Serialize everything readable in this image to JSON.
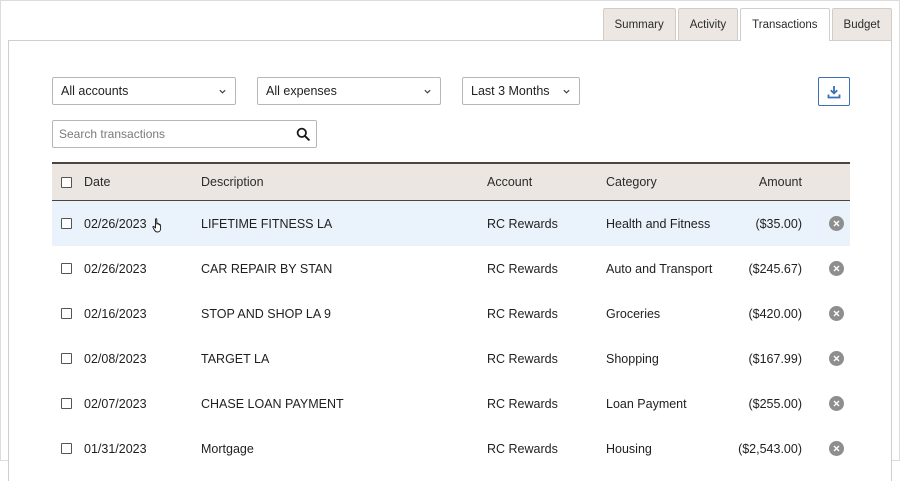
{
  "tabs": [
    {
      "label": "Summary",
      "active": false
    },
    {
      "label": "Activity",
      "active": false
    },
    {
      "label": "Transactions",
      "active": true
    },
    {
      "label": "Budget",
      "active": false
    }
  ],
  "filters": {
    "accounts": "All accounts",
    "expenses": "All expenses",
    "range": "Last 3 Months"
  },
  "icons": {
    "download": "download-icon",
    "search": "search-icon",
    "dropdown": "chevron-down-icon",
    "remove": "remove-circle-icon",
    "cursor": "hand-pointer-icon"
  },
  "search": {
    "placeholder": "Search transactions",
    "value": ""
  },
  "table": {
    "headers": {
      "date": "Date",
      "description": "Description",
      "account": "Account",
      "category": "Category",
      "amount": "Amount"
    },
    "rows": [
      {
        "date": "02/26/2023",
        "description": "LIFETIME FITNESS LA",
        "account": "RC Rewards",
        "category": "Health and Fitness",
        "amount": "($35.00)"
      },
      {
        "date": "02/26/2023",
        "description": "CAR REPAIR BY STAN",
        "account": "RC Rewards",
        "category": "Auto and Transport",
        "amount": "($245.67)"
      },
      {
        "date": "02/16/2023",
        "description": "STOP AND SHOP LA 9",
        "account": "RC Rewards",
        "category": "Groceries",
        "amount": "($420.00)"
      },
      {
        "date": "02/08/2023",
        "description": "TARGET LA",
        "account": "RC Rewards",
        "category": "Shopping",
        "amount": "($167.99)"
      },
      {
        "date": "02/07/2023",
        "description": "CHASE LOAN PAYMENT",
        "account": "RC Rewards",
        "category": "Loan Payment",
        "amount": "($255.00)"
      },
      {
        "date": "01/31/2023",
        "description": "Mortgage",
        "account": "RC Rewards",
        "category": "Housing",
        "amount": "($2,543.00)"
      }
    ]
  },
  "colors": {
    "accent": "#3b6fb6",
    "header_bg": "#ebe6e1",
    "highlight_row": "#eaf3fb",
    "remove_icon": "#8e8e8e"
  }
}
